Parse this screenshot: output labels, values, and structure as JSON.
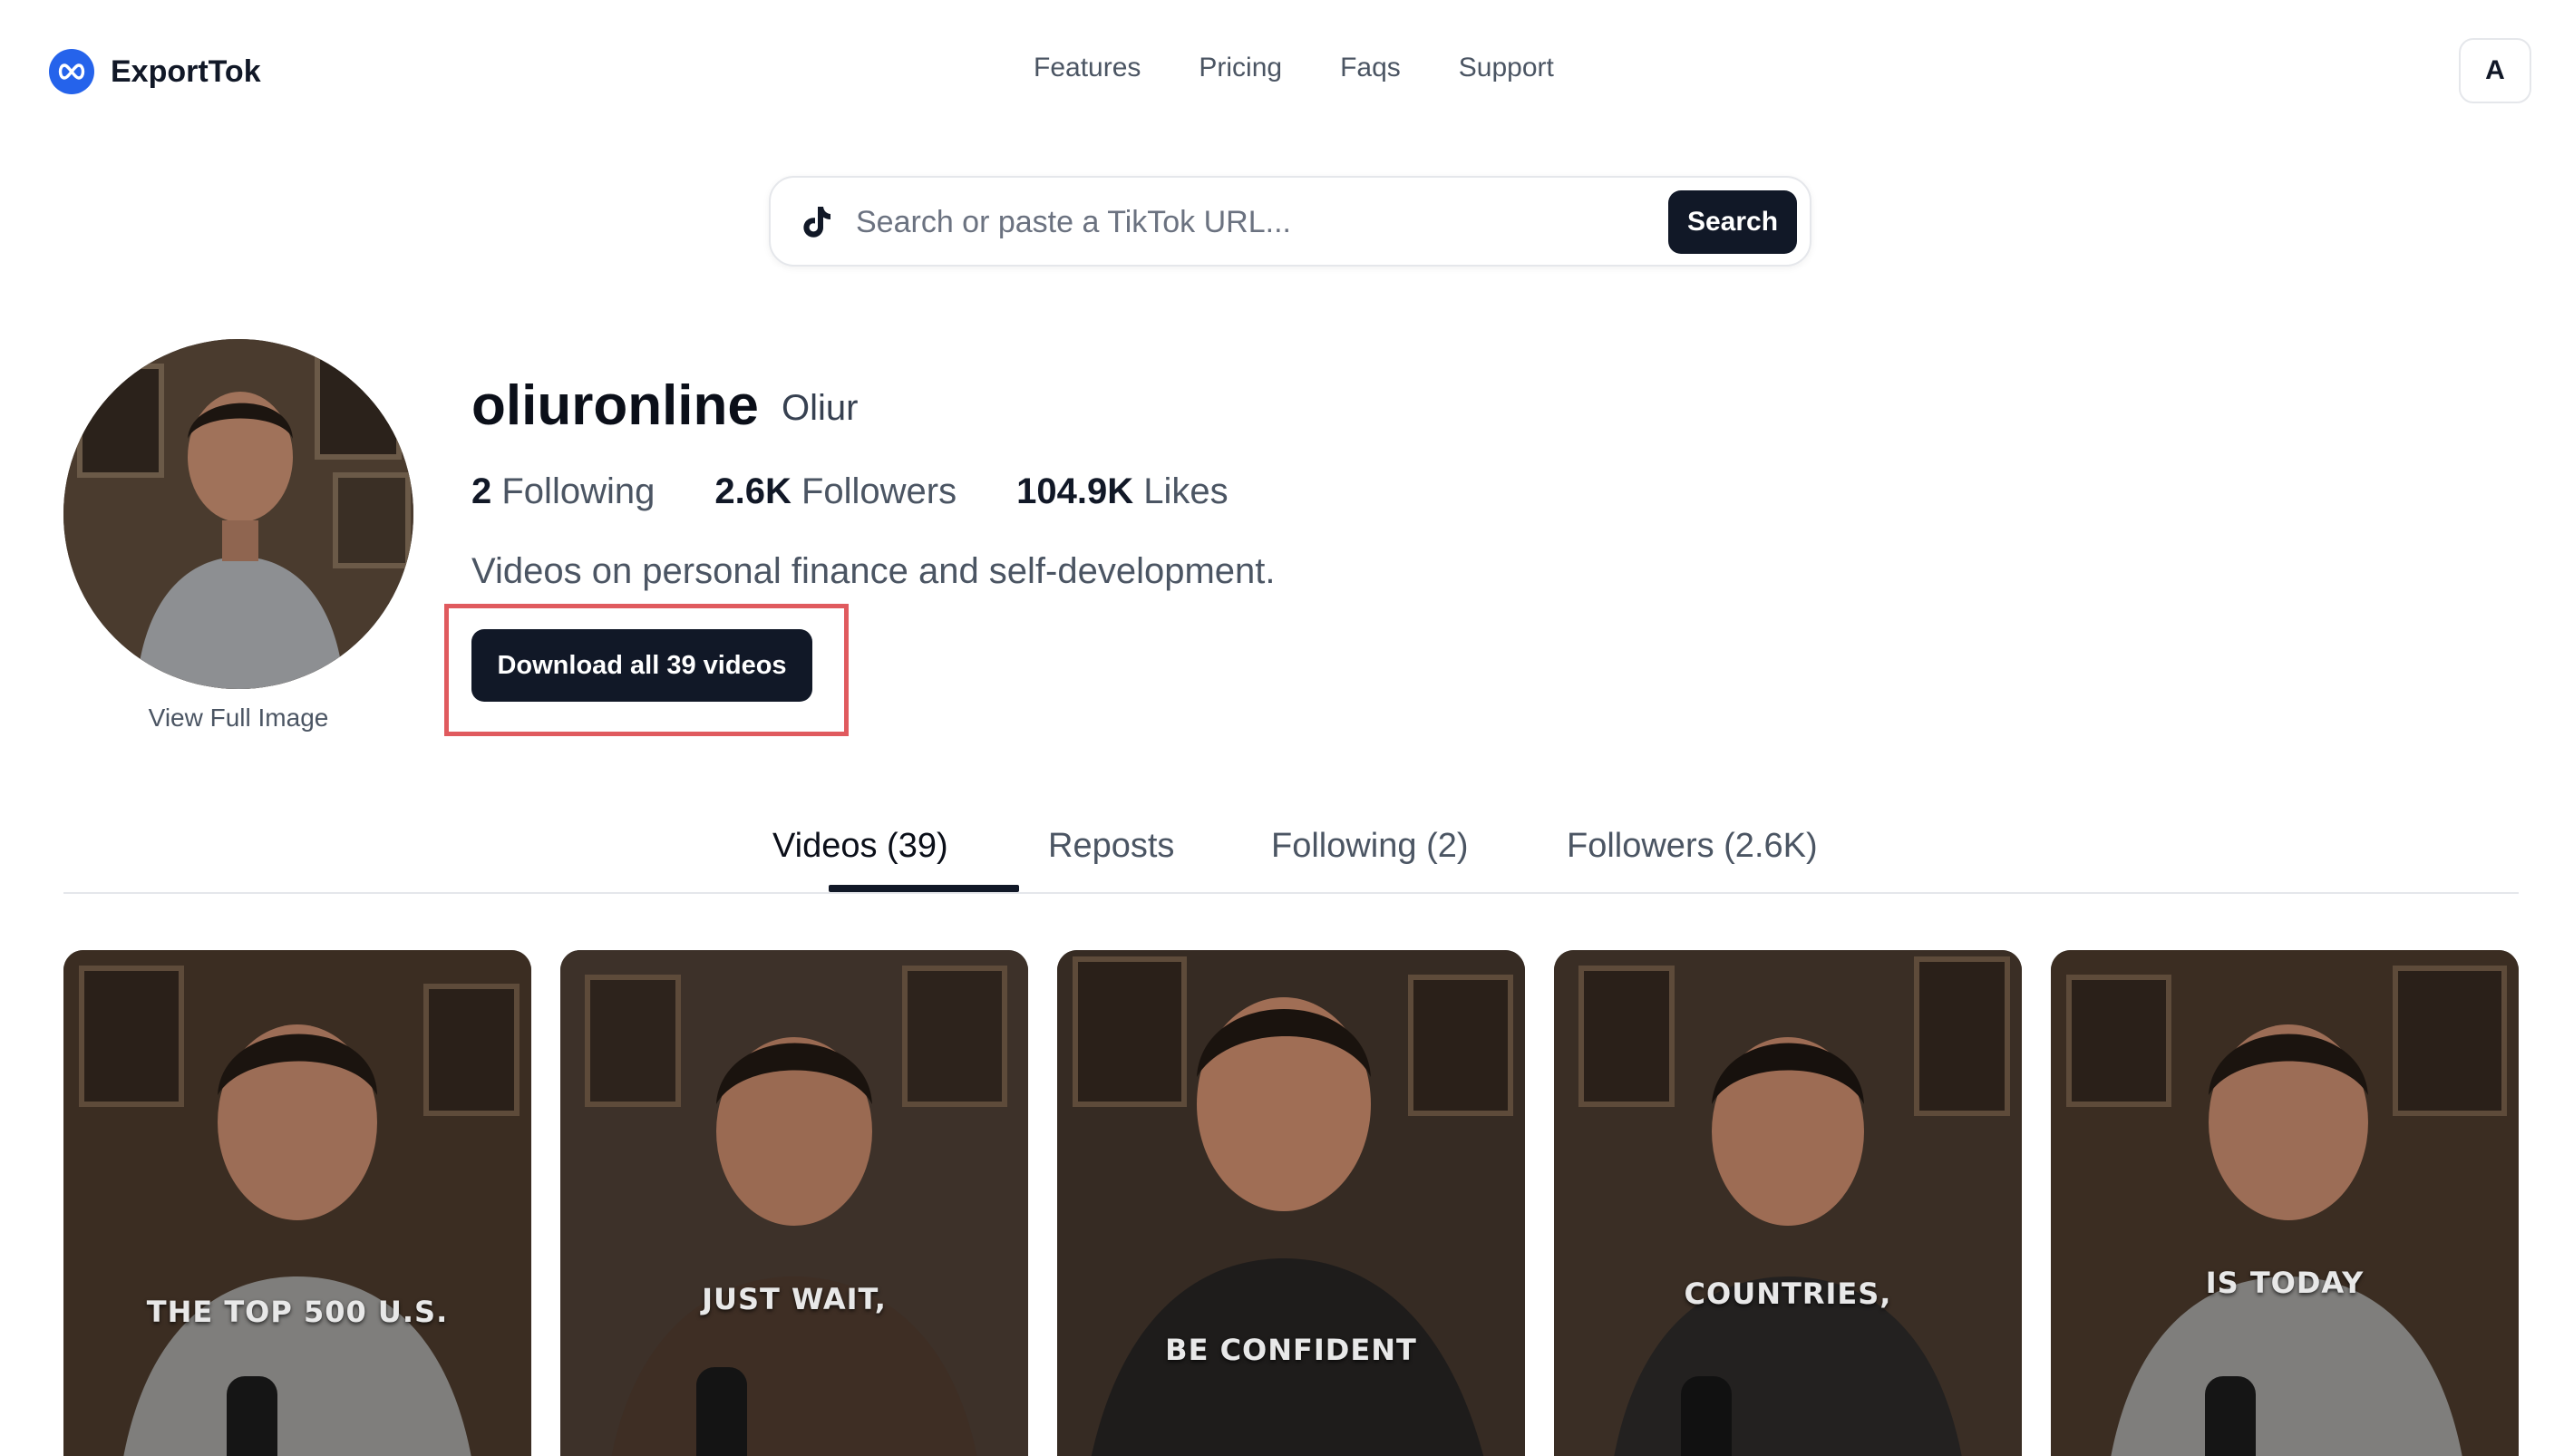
{
  "header": {
    "brand": "ExportTok",
    "nav": [
      "Features",
      "Pricing",
      "Faqs",
      "Support"
    ],
    "account_initial": "A"
  },
  "search": {
    "placeholder": "Search or paste a TikTok URL...",
    "button": "Search"
  },
  "profile": {
    "view_full_image": "View Full Image",
    "username": "oliuronline",
    "display_name": "Oliur",
    "stats": {
      "following_count": "2",
      "following_label": "Following",
      "followers_count": "2.6K",
      "followers_label": "Followers",
      "likes_count": "104.9K",
      "likes_label": "Likes"
    },
    "bio": "Videos on personal finance and self-development.",
    "download_button": "Download all 39 videos"
  },
  "tabs": [
    "Videos (39)",
    "Reposts",
    "Following (2)",
    "Followers (2.6K)"
  ],
  "active_tab": "Videos (39)",
  "videos": [
    {
      "caption": "THE TOP 500 U.S."
    },
    {
      "caption": "JUST WAIT,"
    },
    {
      "caption": "BE CONFIDENT"
    },
    {
      "caption": "COUNTRIES,"
    },
    {
      "caption": "IS TODAY"
    }
  ],
  "colors": {
    "primary_dark": "#111827",
    "brand_blue": "#2563eb",
    "highlight_red": "#e05a5e",
    "muted_text": "#4b5563"
  }
}
